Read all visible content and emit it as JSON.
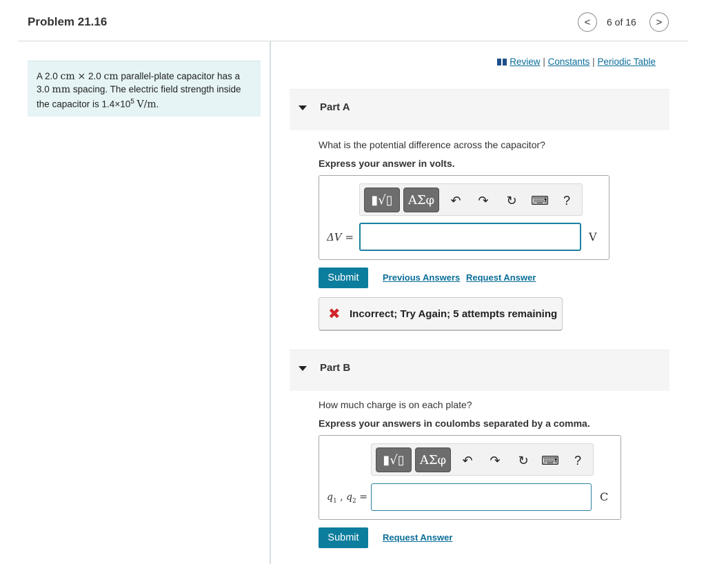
{
  "header": {
    "title": "Problem 21.16",
    "nav_count": "6 of 16",
    "prev_symbol": "<",
    "next_symbol": ">"
  },
  "statement": {
    "pre": "A 2.0",
    "u1": "cm",
    "times": "×",
    "mid1": "2.0",
    "u2": "cm",
    "mid2": "parallel-plate capacitor has a",
    "mid3": "3.0",
    "u3": "mm",
    "mid4": "spacing. The electric field strength inside the capacitor is 1.4×10",
    "exp": "5",
    "u4": "V/m",
    "end": "."
  },
  "resources": {
    "review": "Review",
    "sep1": "|",
    "constants": "Constants",
    "sep2": "|",
    "periodic": "Periodic Table"
  },
  "toolbar": {
    "templates_glyph": "▮√▯",
    "greek_glyph": "ΑΣφ",
    "undo_glyph": "↶",
    "redo_glyph": "↷",
    "reset_glyph": "↻",
    "keyboard_glyph": "⌨",
    "help_glyph": "?"
  },
  "partA": {
    "label": "Part A",
    "question": "What is the potential difference across the capacitor?",
    "instruction": "Express your answer in volts.",
    "var_label": "ΔV",
    "eq": "=",
    "input_value": "",
    "unit": "V",
    "submit": "Submit",
    "previous_answers": "Previous Answers",
    "request_answer": "Request Answer",
    "feedback_icon": "✖",
    "feedback": "Incorrect; Try Again; 5 attempts remaining"
  },
  "partB": {
    "label": "Part B",
    "question": "How much charge is on each plate?",
    "instruction": "Express your answers in coulombs separated by a comma.",
    "var_q1": "q",
    "sub1": "1",
    "comma": ",",
    "var_q2": "q",
    "sub2": "2",
    "eq": "=",
    "input_value": "",
    "unit": "C",
    "submit": "Submit",
    "request_answer": "Request Answer"
  },
  "colors": {
    "accent": "#0c7d9d",
    "statement_bg": "#e6f4f5",
    "error": "#d0232a",
    "link": "#0b6e99"
  }
}
